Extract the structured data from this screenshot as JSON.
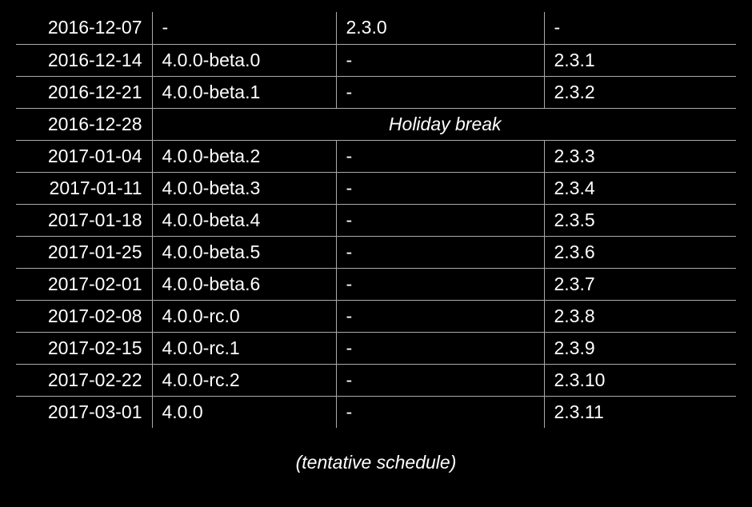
{
  "table": {
    "rows": [
      {
        "date": "2016-12-07",
        "beta": "-",
        "stable1": "2.3.0",
        "stable2": "-"
      },
      {
        "date": "2016-12-14",
        "beta": "4.0.0-beta.0",
        "stable1": "-",
        "stable2": "2.3.1"
      },
      {
        "date": "2016-12-21",
        "beta": "4.0.0-beta.1",
        "stable1": "-",
        "stable2": "2.3.2"
      },
      {
        "date": "2016-12-28",
        "holiday": "Holiday break"
      },
      {
        "date": "2017-01-04",
        "beta": "4.0.0-beta.2",
        "stable1": "-",
        "stable2": "2.3.3"
      },
      {
        "date": "2017-01-11",
        "beta": "4.0.0-beta.3",
        "stable1": "-",
        "stable2": "2.3.4"
      },
      {
        "date": "2017-01-18",
        "beta": "4.0.0-beta.4",
        "stable1": "-",
        "stable2": "2.3.5"
      },
      {
        "date": "2017-01-25",
        "beta": "4.0.0-beta.5",
        "stable1": "-",
        "stable2": "2.3.6"
      },
      {
        "date": "2017-02-01",
        "beta": "4.0.0-beta.6",
        "stable1": "-",
        "stable2": "2.3.7"
      },
      {
        "date": "2017-02-08",
        "beta": "4.0.0-rc.0",
        "stable1": "-",
        "stable2": "2.3.8"
      },
      {
        "date": "2017-02-15",
        "beta": "4.0.0-rc.1",
        "stable1": "-",
        "stable2": "2.3.9"
      },
      {
        "date": "2017-02-22",
        "beta": "4.0.0-rc.2",
        "stable1": "-",
        "stable2": "2.3.10"
      },
      {
        "date": "2017-03-01",
        "beta": "4.0.0",
        "stable1": "-",
        "stable2": "2.3.11"
      }
    ]
  },
  "caption": "(tentative schedule)"
}
